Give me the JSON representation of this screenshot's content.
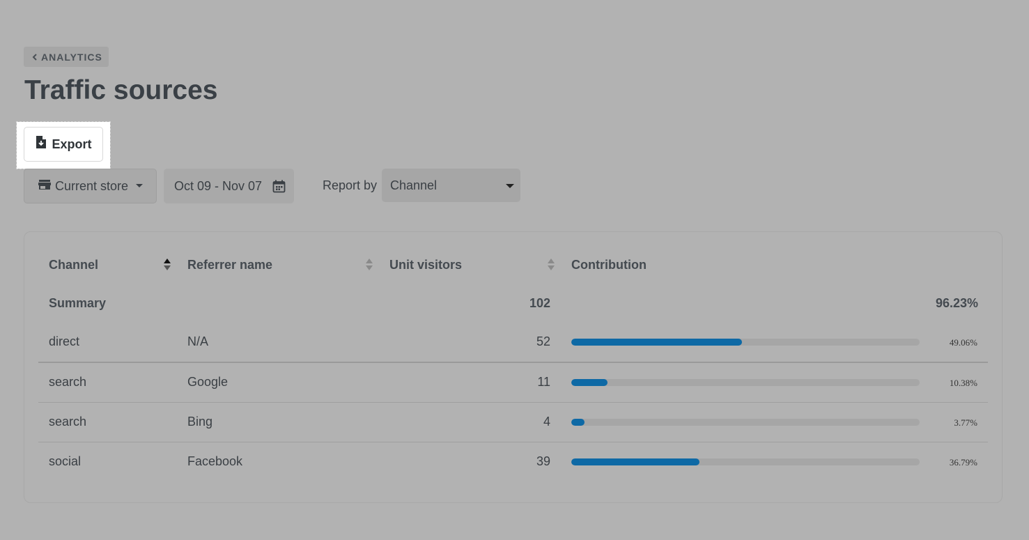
{
  "breadcrumb": {
    "label": "ANALYTICS"
  },
  "page": {
    "title": "Traffic sources"
  },
  "toolbar": {
    "export_label": "Export"
  },
  "filters": {
    "store_label": "Current store",
    "date_range": "Oct 09 - Nov 07",
    "report_by_label": "Report by",
    "report_by_value": "Channel"
  },
  "table": {
    "columns": [
      "Channel",
      "Referrer name",
      "Unit visitors",
      "Contribution"
    ],
    "summary": {
      "label": "Summary",
      "visitors": "102",
      "contribution": "96.23%"
    },
    "rows": [
      {
        "channel": "direct",
        "referrer": "N/A",
        "visitors": "52",
        "contribution": "49.06%",
        "fraction": 0.4906
      },
      {
        "channel": "search",
        "referrer": "Google",
        "visitors": "11",
        "contribution": "10.38%",
        "fraction": 0.1038
      },
      {
        "channel": "search",
        "referrer": "Bing",
        "visitors": "4",
        "contribution": "3.77%",
        "fraction": 0.0377
      },
      {
        "channel": "social",
        "referrer": "Facebook",
        "visitors": "39",
        "contribution": "36.79%",
        "fraction": 0.3679
      }
    ]
  },
  "colors": {
    "accent": "#0e69a5",
    "background": "#b2b2b2"
  }
}
